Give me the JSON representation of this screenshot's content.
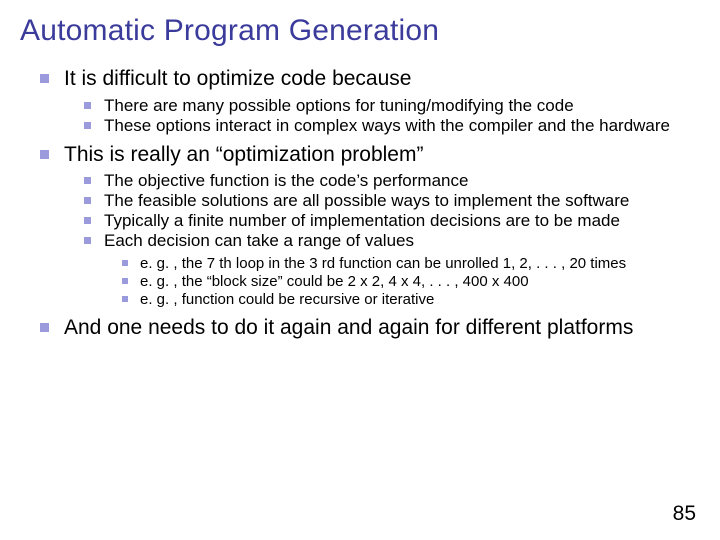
{
  "title": "Automatic Program Generation",
  "bullets": {
    "p1": "It is difficult to optimize code because",
    "p1_1": "There are many possible options for tuning/modifying the code",
    "p1_2": "These options interact in complex ways with the compiler and the hardware",
    "p2": "This is really an “optimization problem”",
    "p2_1": "The objective function is the code’s performance",
    "p2_2": "The feasible solutions are all possible ways to implement the software",
    "p2_3": "Typically a finite number of implementation decisions are to be made",
    "p2_4": "Each decision can take a range of values",
    "p2_4_1": "e. g. , the 7 th loop in the 3 rd function can be unrolled 1, 2, . . . , 20 times",
    "p2_4_2": "e. g. , the “block size” could be 2 x 2, 4 x 4, . . . , 400 x 400",
    "p2_4_3": "e. g. , function could be recursive or iterative",
    "p3": "And one needs to do it again and again for different platforms"
  },
  "page_number": "85"
}
